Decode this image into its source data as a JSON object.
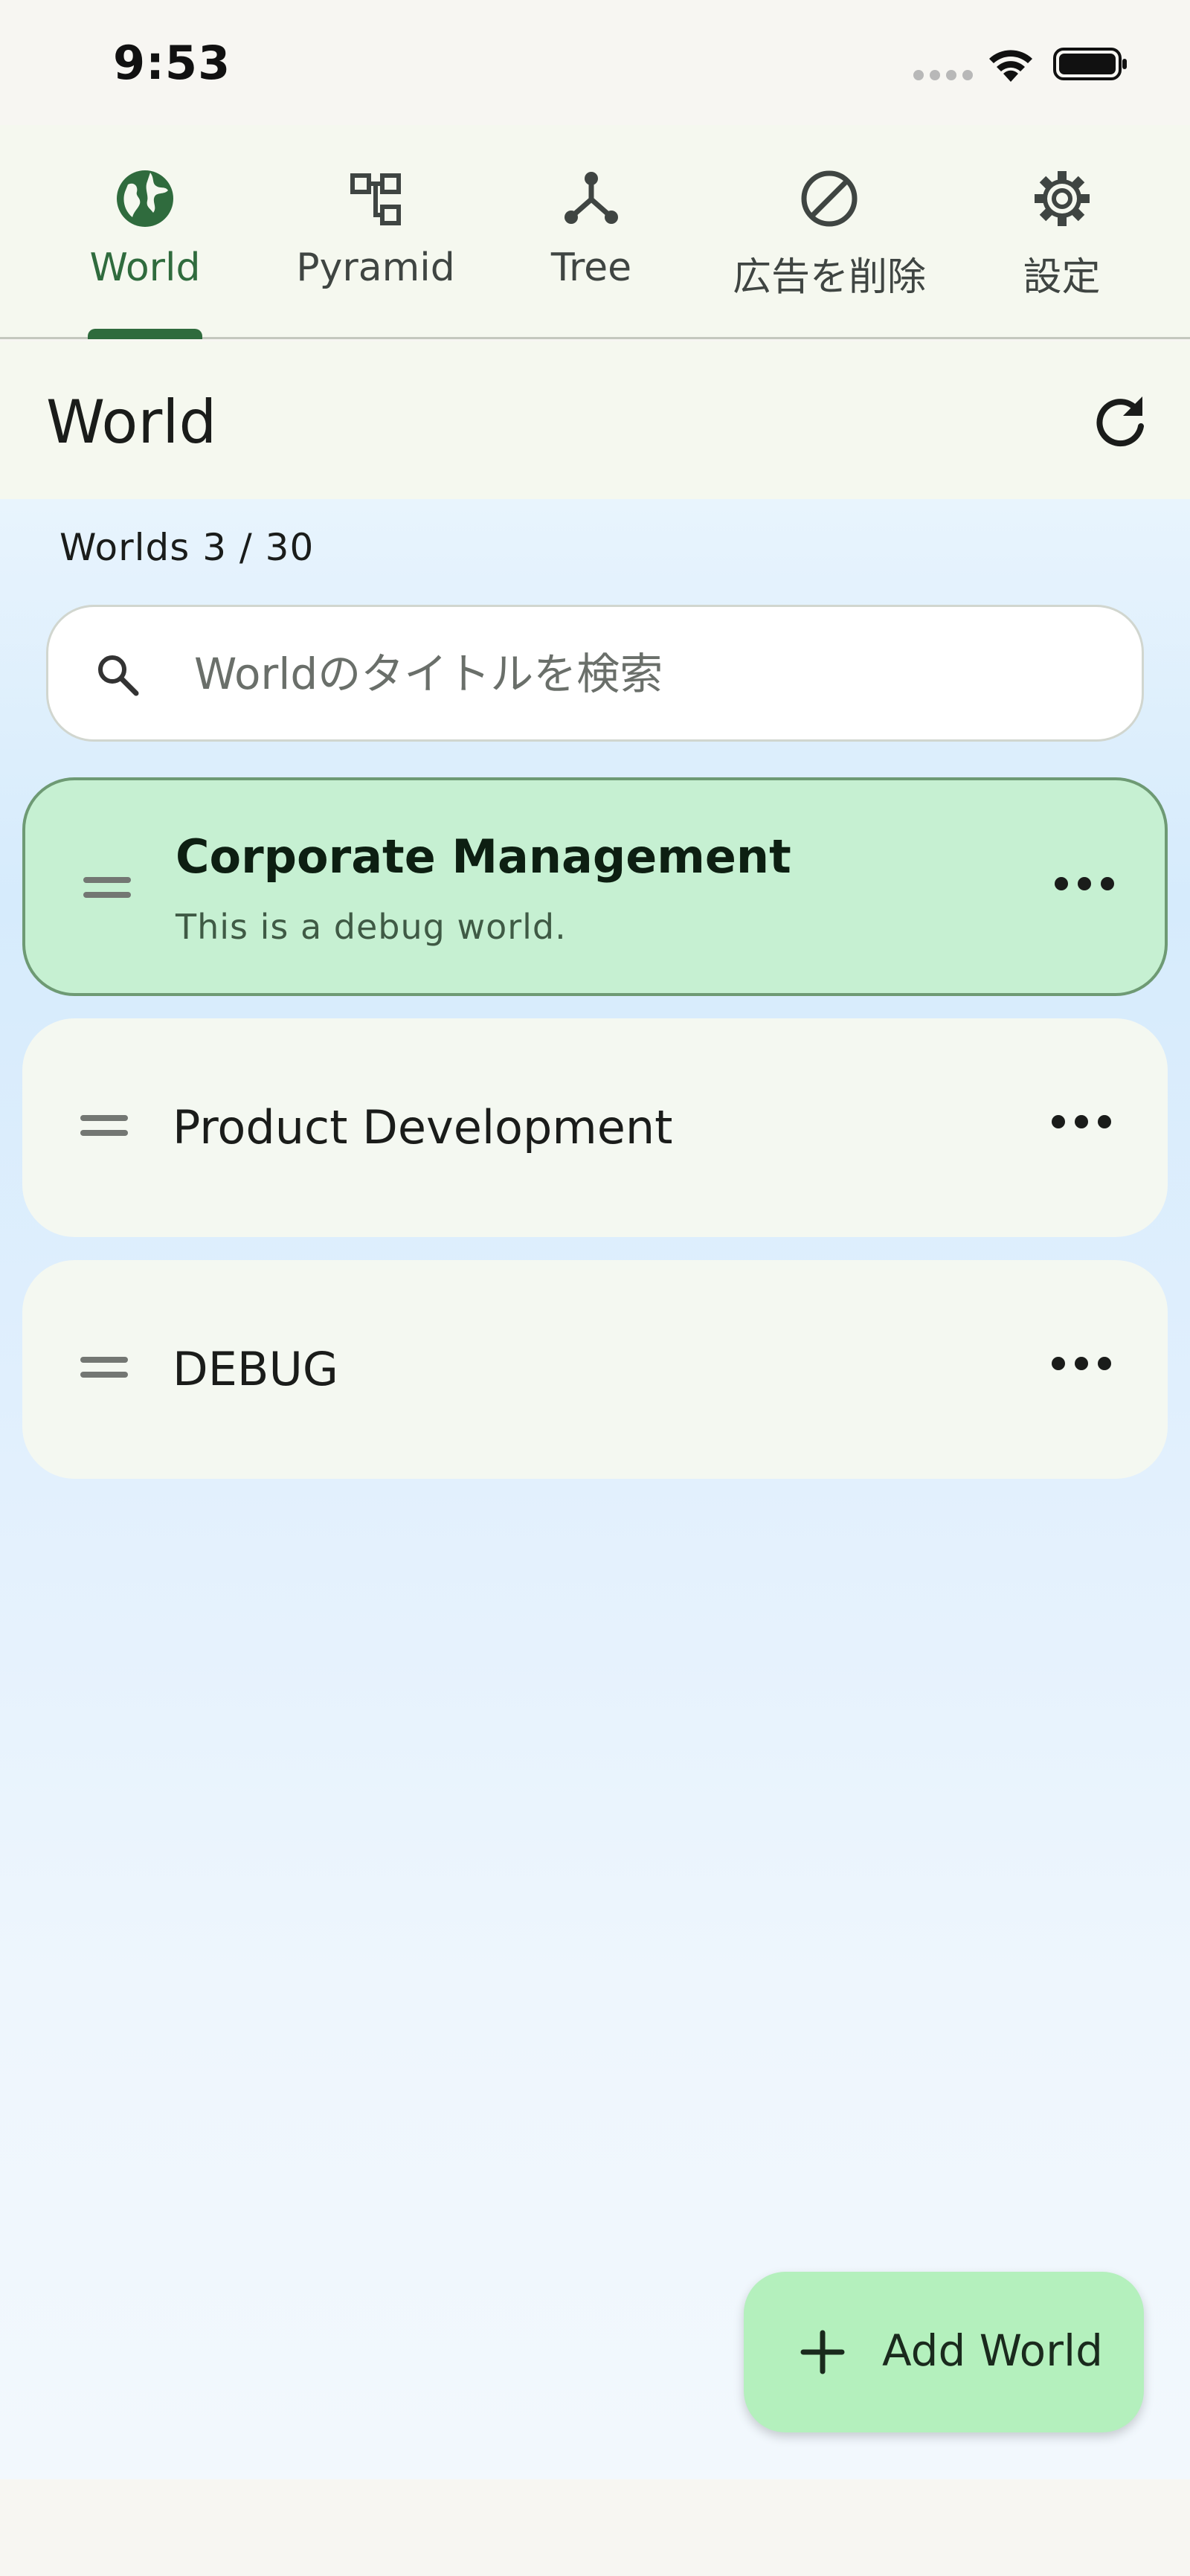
{
  "status_bar": {
    "time": "9:53"
  },
  "tabs": [
    {
      "label": "World",
      "icon": "globe-icon",
      "active": true
    },
    {
      "label": "Pyramid",
      "icon": "hierarchy-icon",
      "active": false
    },
    {
      "label": "Tree",
      "icon": "tree-icon",
      "active": false
    },
    {
      "label": "広告を削除",
      "icon": "block-icon",
      "active": false
    },
    {
      "label": "設定",
      "icon": "gear-icon",
      "active": false
    }
  ],
  "header": {
    "title": "World",
    "refresh_icon": "refresh-icon"
  },
  "main": {
    "count_label": "Worlds 3 / 30",
    "search": {
      "placeholder": "Worldのタイトルを検索",
      "value": ""
    },
    "worlds": [
      {
        "title": "Corporate Management",
        "subtitle": "This is a debug world.",
        "selected": true
      },
      {
        "title": "Product Development",
        "subtitle": "",
        "selected": false
      },
      {
        "title": "DEBUG",
        "subtitle": "",
        "selected": false
      }
    ]
  },
  "fab": {
    "label": "Add World",
    "icon": "plus-icon"
  },
  "colors": {
    "accent": "#2f6b3d",
    "selected_card": "#c6f0d2",
    "card": "#f4f8f1",
    "fab": "#b4f0bd",
    "tab_bar": "#f5f8ef"
  }
}
